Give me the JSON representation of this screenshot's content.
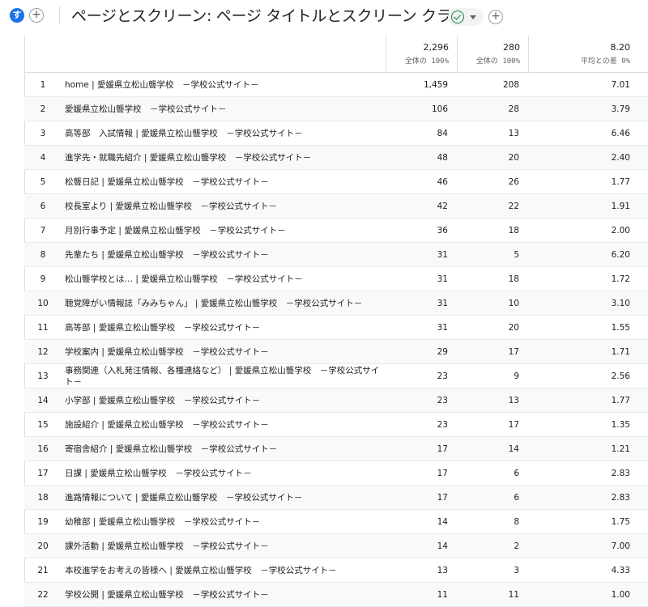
{
  "header": {
    "avatar_letter": "す",
    "title": "ページとスクリーン: ページ タイトルとスクリーン クラス",
    "add_icon": "plus-circle-icon",
    "status_icon": "check-circle-icon",
    "dropdown_icon": "caret-down-icon"
  },
  "table": {
    "totals": [
      {
        "value": "2,296",
        "note": "全体の 100%"
      },
      {
        "value": "280",
        "note": "全体の 100%"
      },
      {
        "value": "8.20",
        "note": "平均との差 0%"
      }
    ],
    "rows": [
      {
        "idx": "1",
        "title": "home | 愛媛県立松山聾学校　－学校公式サイト－",
        "v1": "1,459",
        "v2": "208",
        "v3": "7.01"
      },
      {
        "idx": "2",
        "title": "愛媛県立松山聾学校　－学校公式サイト－",
        "v1": "106",
        "v2": "28",
        "v3": "3.79"
      },
      {
        "idx": "3",
        "title": "高等部　入試情報 | 愛媛県立松山聾学校　－学校公式サイト－",
        "v1": "84",
        "v2": "13",
        "v3": "6.46"
      },
      {
        "idx": "4",
        "title": "進学先・就職先紹介 | 愛媛県立松山聾学校　－学校公式サイト－",
        "v1": "48",
        "v2": "20",
        "v3": "2.40"
      },
      {
        "idx": "5",
        "title": "松聾日記 | 愛媛県立松山聾学校　－学校公式サイト－",
        "v1": "46",
        "v2": "26",
        "v3": "1.77"
      },
      {
        "idx": "6",
        "title": "校長室より | 愛媛県立松山聾学校　－学校公式サイト－",
        "v1": "42",
        "v2": "22",
        "v3": "1.91"
      },
      {
        "idx": "7",
        "title": "月別行事予定 | 愛媛県立松山聾学校　－学校公式サイト－",
        "v1": "36",
        "v2": "18",
        "v3": "2.00"
      },
      {
        "idx": "8",
        "title": "先輩たち | 愛媛県立松山聾学校　－学校公式サイト－",
        "v1": "31",
        "v2": "5",
        "v3": "6.20"
      },
      {
        "idx": "9",
        "title": "松山聾学校とは… | 愛媛県立松山聾学校　－学校公式サイト－",
        "v1": "31",
        "v2": "18",
        "v3": "1.72"
      },
      {
        "idx": "10",
        "title": "聴覚障がい情報誌「みみちゃん」 | 愛媛県立松山聾学校　－学校公式サイト－",
        "v1": "31",
        "v2": "10",
        "v3": "3.10"
      },
      {
        "idx": "11",
        "title": "高等部 | 愛媛県立松山聾学校　－学校公式サイト－",
        "v1": "31",
        "v2": "20",
        "v3": "1.55"
      },
      {
        "idx": "12",
        "title": "学校案内 | 愛媛県立松山聾学校　－学校公式サイト－",
        "v1": "29",
        "v2": "17",
        "v3": "1.71"
      },
      {
        "idx": "13",
        "title": "事務関連（入札発注情報、各種連絡など） | 愛媛県立松山聾学校　－学校公式サイト－",
        "v1": "23",
        "v2": "9",
        "v3": "2.56"
      },
      {
        "idx": "14",
        "title": "小学部 | 愛媛県立松山聾学校　－学校公式サイト－",
        "v1": "23",
        "v2": "13",
        "v3": "1.77"
      },
      {
        "idx": "15",
        "title": "施設紹介 | 愛媛県立松山聾学校　－学校公式サイト－",
        "v1": "23",
        "v2": "17",
        "v3": "1.35"
      },
      {
        "idx": "16",
        "title": "寄宿舎紹介 | 愛媛県立松山聾学校　－学校公式サイト－",
        "v1": "17",
        "v2": "14",
        "v3": "1.21"
      },
      {
        "idx": "17",
        "title": "日課 | 愛媛県立松山聾学校　－学校公式サイト－",
        "v1": "17",
        "v2": "6",
        "v3": "2.83"
      },
      {
        "idx": "18",
        "title": "進路情報について | 愛媛県立松山聾学校　－学校公式サイト－",
        "v1": "17",
        "v2": "6",
        "v3": "2.83"
      },
      {
        "idx": "19",
        "title": "幼稚部 | 愛媛県立松山聾学校　－学校公式サイト－",
        "v1": "14",
        "v2": "8",
        "v3": "1.75"
      },
      {
        "idx": "20",
        "title": "課外活動 | 愛媛県立松山聾学校　－学校公式サイト－",
        "v1": "14",
        "v2": "2",
        "v3": "7.00"
      },
      {
        "idx": "21",
        "title": "本校進学をお考えの皆様へ | 愛媛県立松山聾学校　－学校公式サイト－",
        "v1": "13",
        "v2": "3",
        "v3": "4.33"
      },
      {
        "idx": "22",
        "title": "学校公開 | 愛媛県立松山聾学校　－学校公式サイト－",
        "v1": "11",
        "v2": "11",
        "v3": "1.00"
      }
    ]
  }
}
